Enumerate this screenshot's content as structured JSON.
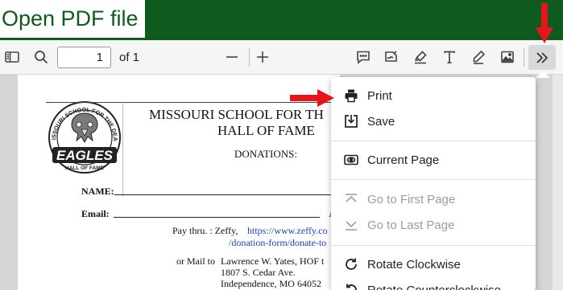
{
  "banner": {
    "title": "Open PDF file"
  },
  "toolbar": {
    "page_value": "1",
    "page_total": "of 1",
    "icons": [
      "sidebar-toggle-icon",
      "search-icon",
      "zoom-out-icon",
      "zoom-in-icon",
      "comment-icon",
      "sign-icon",
      "highlight-icon",
      "text-icon",
      "draw-icon",
      "image-icon",
      "more-tools-icon"
    ]
  },
  "document": {
    "title_line1": "MISSOURI SCHOOL FOR TH",
    "title_line2": "HALL OF FAME",
    "donations": "DONATIONS:",
    "name_label": "NAME:",
    "email_label": "Email:",
    "email_trailing": "A",
    "pay_label": "Pay thru. :  Zeffy,",
    "pay_link1": "https://www.zeffy.co",
    "pay_link2": "/donation-form/donate-to",
    "mail_label": "or Mail to",
    "mail_line1": "Lawrence W. Yates, HOF t",
    "mail_line2": "1807 S. Cedar Ave.",
    "mail_line3": "Independence, MO 64052",
    "seal_top_text": "MISSOURI SCHOOL FOR THE DEAF",
    "seal_main_text": "EAGLES",
    "seal_sub_text": "HALL OF FAME"
  },
  "menu": {
    "items": [
      {
        "label": "Print",
        "icon": "printer-icon",
        "enabled": true
      },
      {
        "label": "Save",
        "icon": "save-icon",
        "enabled": true
      },
      {
        "label": "Current Page",
        "icon": "eye-icon",
        "enabled": true
      },
      {
        "label": "Go to First Page",
        "icon": "first-page-icon",
        "enabled": false
      },
      {
        "label": "Go to Last Page",
        "icon": "last-page-icon",
        "enabled": false
      },
      {
        "label": "Rotate Clockwise",
        "icon": "rotate-clockwise-icon",
        "enabled": true
      },
      {
        "label": "Rotate Counterclockwise",
        "icon": "rotate-counterclockwise-icon",
        "enabled": true
      }
    ]
  },
  "colors": {
    "banner_green": "#0f5a1e",
    "annotation_red": "#e8141b",
    "link_blue": "#1a3fc0"
  }
}
